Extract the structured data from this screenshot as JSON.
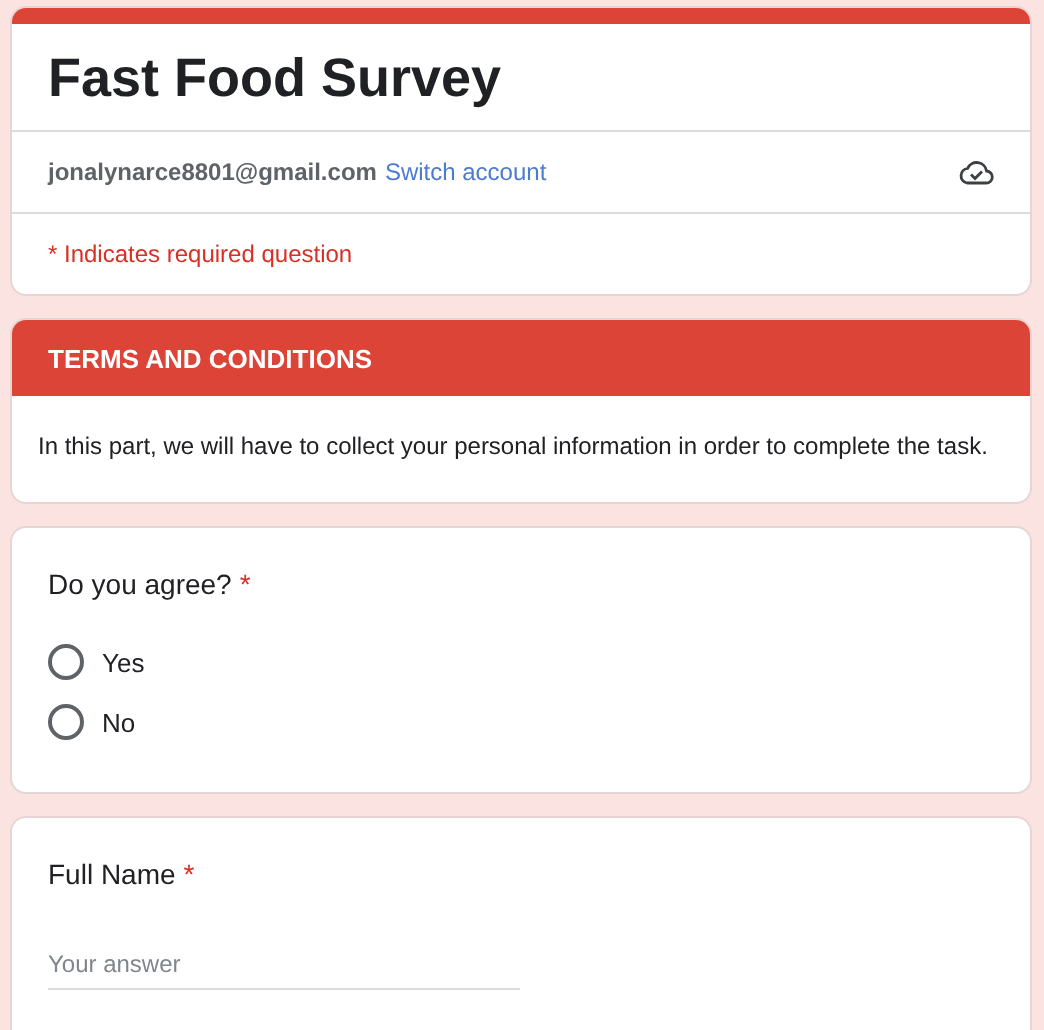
{
  "form": {
    "title": "Fast Food Survey",
    "account": "jonalynarce8801@gmail.com",
    "switch_account": "Switch account",
    "required_note": "* Indicates required question"
  },
  "section": {
    "title": "TERMS AND CONDITIONS",
    "description": "In this part, we will have to collect your personal information in order to complete the task."
  },
  "questions": [
    {
      "kind": "radio",
      "title": "Do you agree?",
      "required": true,
      "required_mark": "*",
      "options": [
        {
          "label": "Yes",
          "selected": false
        },
        {
          "label": "No",
          "selected": false
        }
      ]
    },
    {
      "kind": "text",
      "title": "Full Name",
      "required": true,
      "required_mark": "*",
      "placeholder": "Your answer"
    }
  ]
}
